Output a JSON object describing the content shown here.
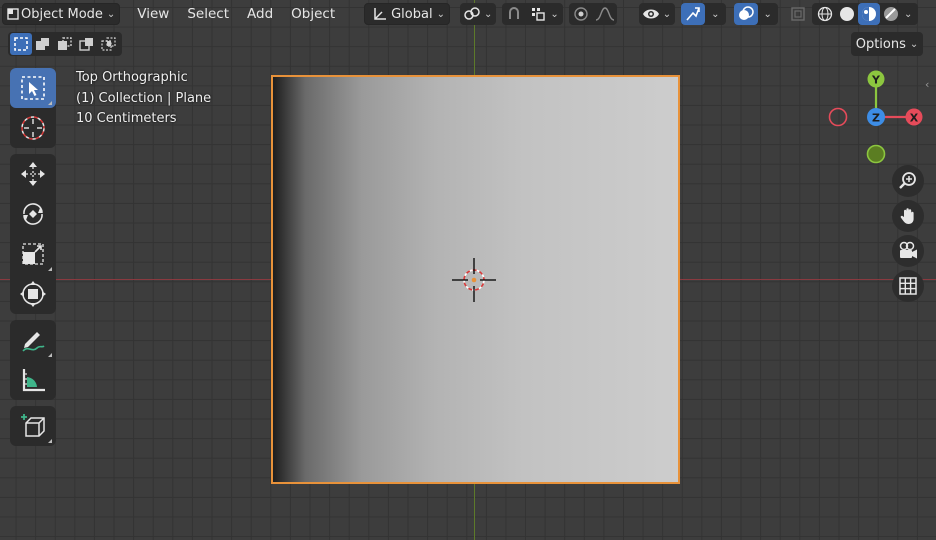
{
  "header": {
    "mode_label": "Object Mode",
    "menus": [
      "View",
      "Select",
      "Add",
      "Object"
    ],
    "orientation_label": "Global"
  },
  "options_label": "Options",
  "viewport_info": {
    "view_name": "Top Orthographic",
    "collection": "(1) Collection | Plane",
    "grid_scale": "10 Centimeters"
  },
  "gizmo": {
    "y_label": "Y",
    "z_label": "Z",
    "x_label": "X"
  },
  "colors": {
    "accent": "#4772b3",
    "selection_outline": "#e8923a",
    "axis_x": "#e64b5a",
    "axis_y": "#8cc63f",
    "axis_z": "#3d8de6"
  }
}
